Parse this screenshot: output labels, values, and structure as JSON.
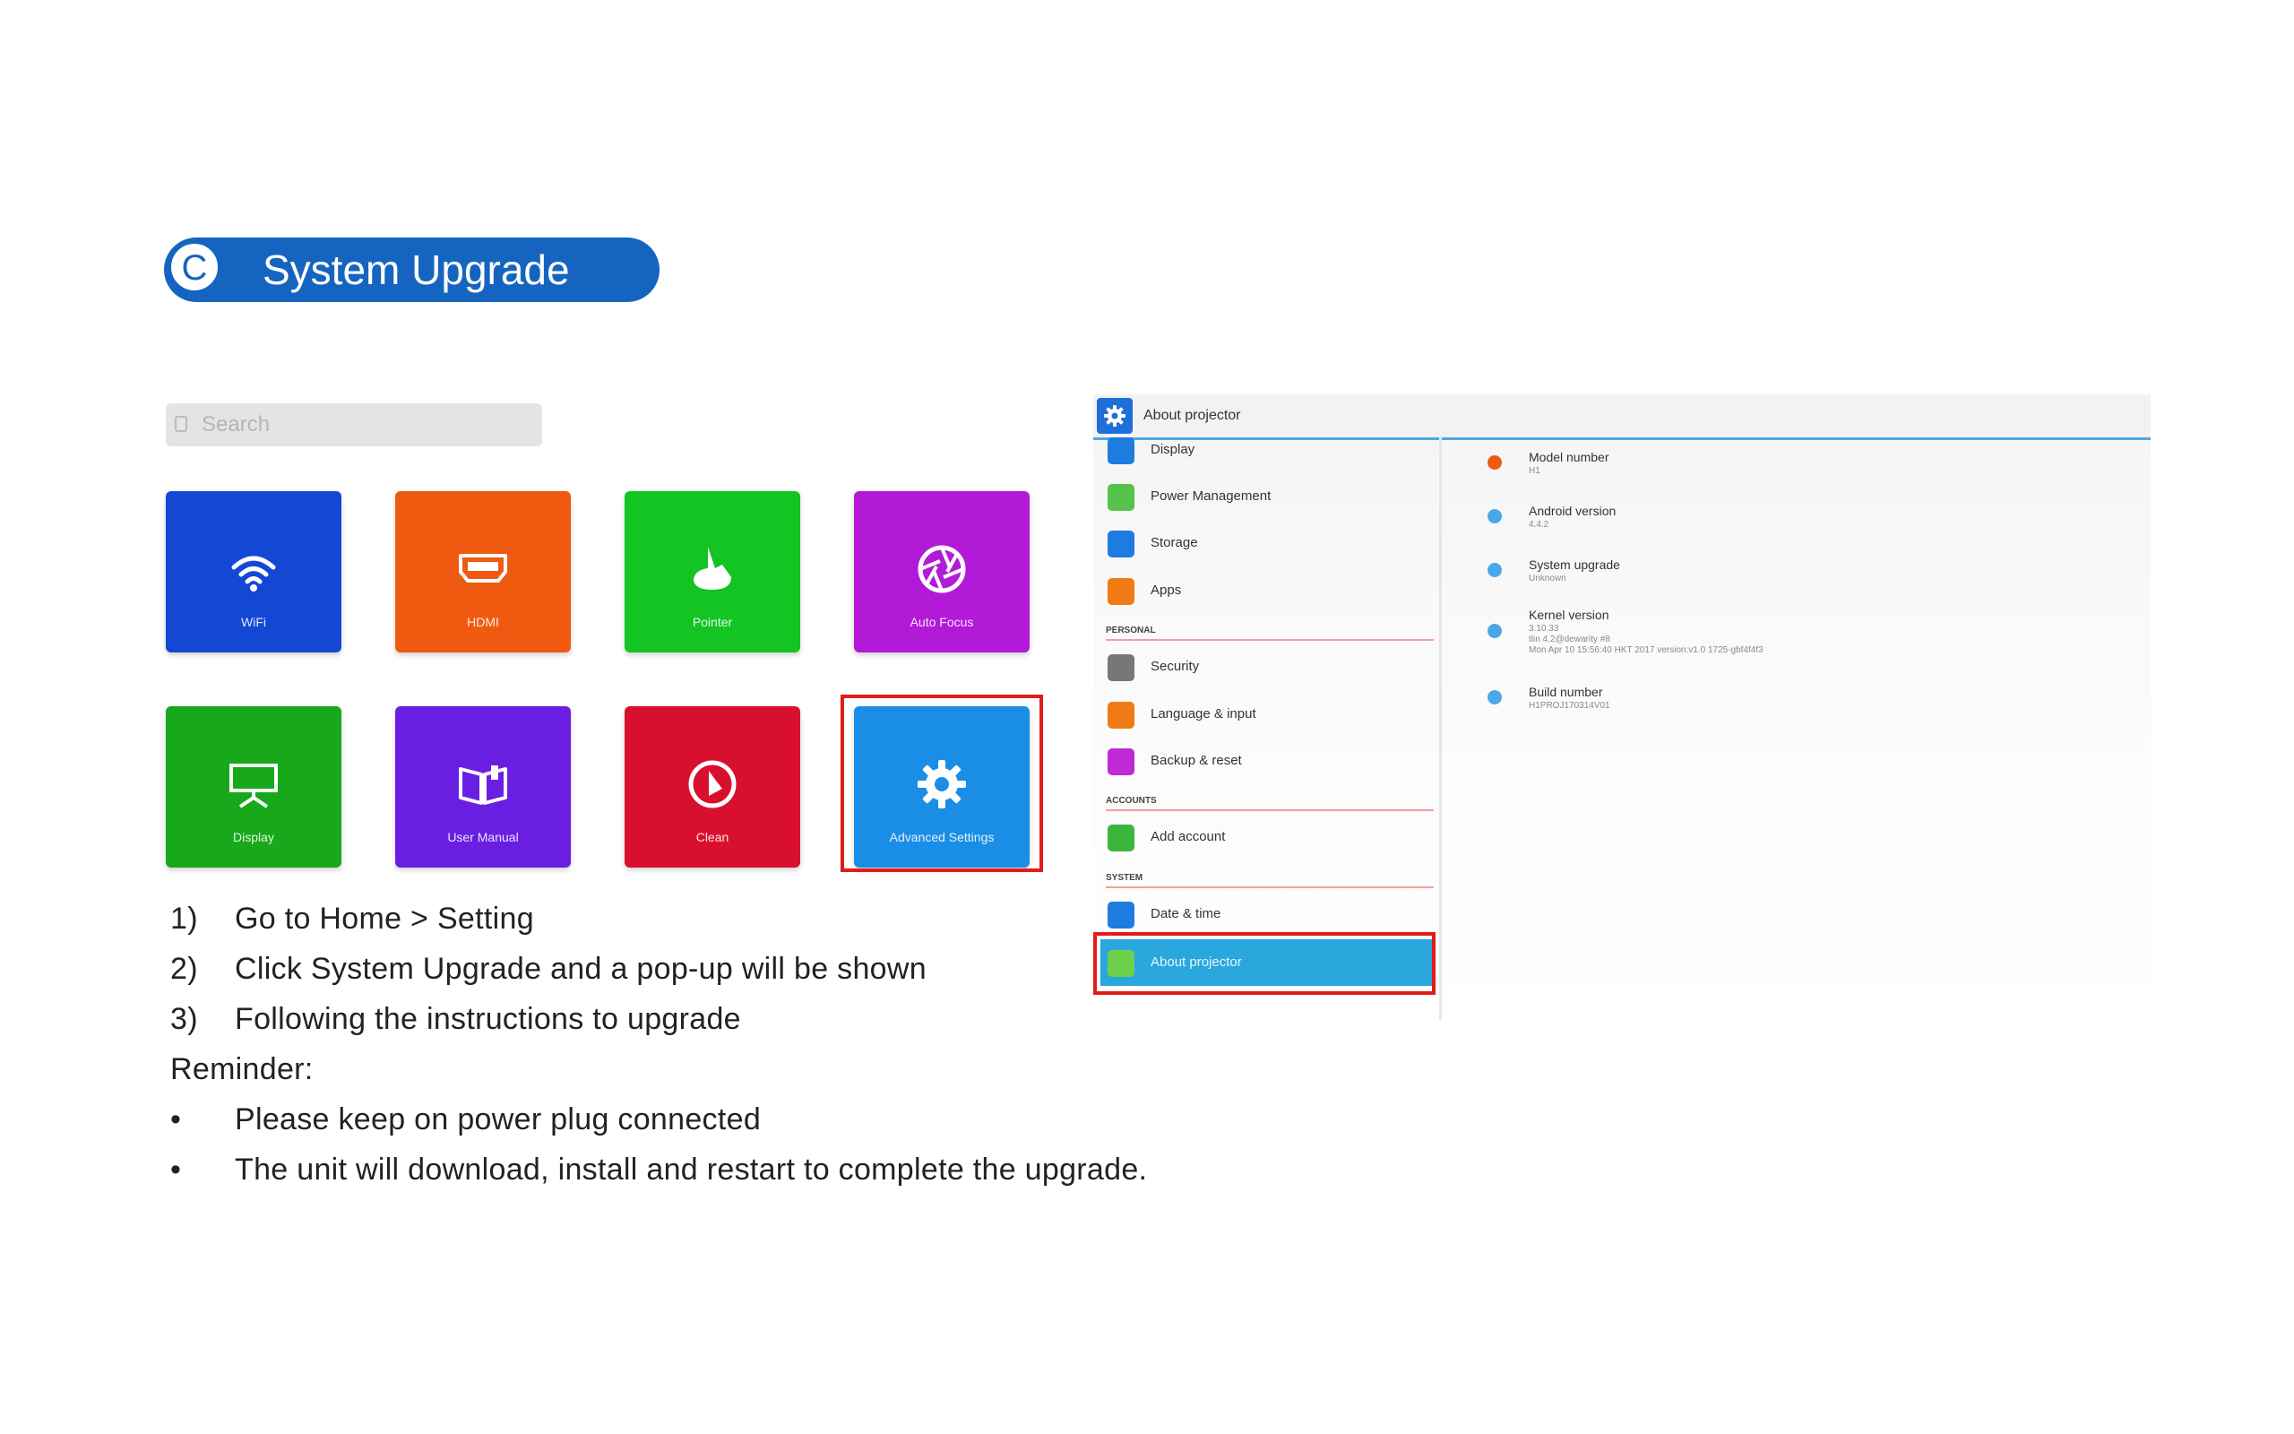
{
  "section": {
    "letter": "C",
    "title": "System Upgrade"
  },
  "search": {
    "placeholder": "Search"
  },
  "tiles": [
    {
      "label": "WiFi",
      "color": "#1448d4",
      "icon": "wifi-icon"
    },
    {
      "label": "HDMI",
      "color": "#f05a10",
      "icon": "hdmi-icon"
    },
    {
      "label": "Pointer",
      "color": "#13c422",
      "icon": "pointer-icon"
    },
    {
      "label": "Auto Focus",
      "color": "#b21ad8",
      "icon": "aperture-icon"
    },
    {
      "label": "Display",
      "color": "#17a81b",
      "icon": "projector-screen-icon"
    },
    {
      "label": "User Manual",
      "color": "#6a1ee2",
      "icon": "book-icon"
    },
    {
      "label": "Clean",
      "color": "#d8102e",
      "icon": "clean-icon"
    },
    {
      "label": "Advanced Settings",
      "color": "#1a8ee6",
      "icon": "gear-icon"
    }
  ],
  "steps": [
    {
      "num": "1)",
      "text": "Go to Home > Setting"
    },
    {
      "num": "2)",
      "text": "Click System Upgrade and a pop-up will be shown"
    },
    {
      "num": "3)",
      "text": "Following the instructions to upgrade"
    }
  ],
  "reminder": {
    "title": "Reminder:",
    "bullets": [
      {
        "mark": "•",
        "text": "Please keep on power plug connected"
      },
      {
        "mark": "•",
        "text": "The unit will download, install and restart to complete the upgrade."
      }
    ]
  },
  "settings": {
    "title": "About projector",
    "items": [
      {
        "label": "Display",
        "color": "#1e7be0"
      },
      {
        "label": "Power Management",
        "color": "#55c24a"
      },
      {
        "label": "Storage",
        "color": "#1e7be0"
      },
      {
        "label": "Apps",
        "color": "#f07a14"
      },
      {
        "header": "PERSONAL"
      },
      {
        "label": "Security",
        "color": "#777777"
      },
      {
        "label": "Language & input",
        "color": "#f07a14"
      },
      {
        "label": "Backup & reset",
        "color": "#c02ad4"
      },
      {
        "header": "ACCOUNTS"
      },
      {
        "label": "Add account",
        "color": "#3cb53c"
      },
      {
        "header": "SYSTEM"
      },
      {
        "label": "Date & time",
        "color": "#1e7be0"
      },
      {
        "label": "About projector",
        "color": "#6ed04a"
      }
    ],
    "info": [
      {
        "title": "Model number",
        "values": [
          "H1"
        ],
        "color": "#f05a10"
      },
      {
        "title": "Android version",
        "values": [
          "4.4.2"
        ],
        "color": "#4aa8e8"
      },
      {
        "title": "System upgrade",
        "values": [
          "Unknown"
        ],
        "color": "#4aa8e8"
      },
      {
        "title": "Kernel version",
        "values": [
          "3.10.33",
          "tlin 4.2@dewarity #8",
          "Mon Apr 10 15:56:40 HKT 2017 version:v1.0 1725-gbf4f4f3"
        ],
        "color": "#4aa8e8"
      },
      {
        "title": "Build number",
        "values": [
          "H1PROJ170314V01"
        ],
        "color": "#4aa8e8"
      }
    ]
  }
}
